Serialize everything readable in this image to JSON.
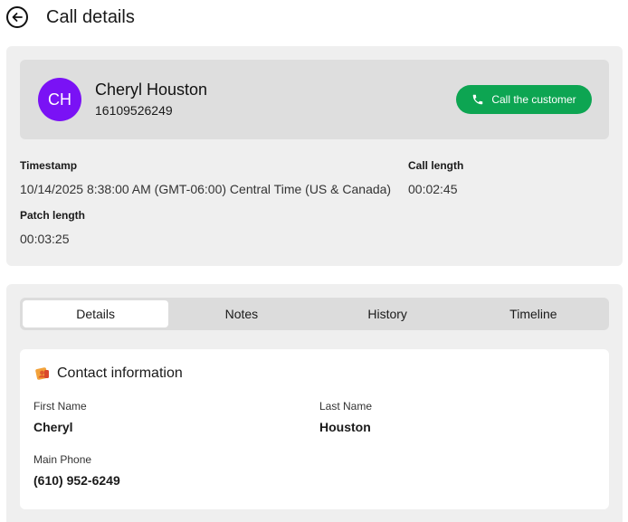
{
  "header": {
    "title": "Call details"
  },
  "customer": {
    "initials": "CH",
    "name": "Cheryl Houston",
    "phone": "16109526249",
    "call_button_label": "Call the customer",
    "avatar_color": "#7a12f5",
    "call_button_color": "#0da552"
  },
  "meta": {
    "timestamp_label": "Timestamp",
    "timestamp_value": "10/14/2025 8:38:00 AM (GMT-06:00) Central Time (US & Canada)",
    "call_length_label": "Call length",
    "call_length_value": "00:02:45",
    "patch_length_label": "Patch length",
    "patch_length_value": "00:03:25"
  },
  "tabs": [
    {
      "label": "Details",
      "active": true
    },
    {
      "label": "Notes",
      "active": false
    },
    {
      "label": "History",
      "active": false
    },
    {
      "label": "Timeline",
      "active": false
    }
  ],
  "contact": {
    "section_title": "Contact information",
    "section_icon": "contact-card-icon",
    "first_name_label": "First Name",
    "first_name_value": "Cheryl",
    "last_name_label": "Last Name",
    "last_name_value": "Houston",
    "main_phone_label": "Main Phone",
    "main_phone_value": "(610) 952-6249"
  }
}
